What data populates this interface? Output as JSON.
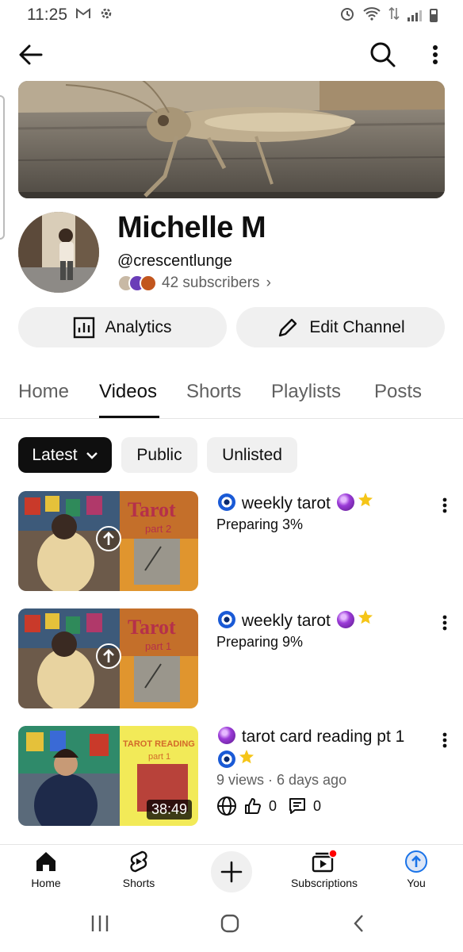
{
  "status_bar": {
    "time": "11:25",
    "left_icons": [
      "gmail-icon",
      "settings-gear-icon"
    ],
    "right_icons": [
      "alarm-icon",
      "wifi-icon",
      "data-arrows-icon",
      "signal-icon",
      "battery-icon"
    ]
  },
  "appbar": {
    "back_icon": "arrow-left-icon",
    "search_icon": "search-icon",
    "more_icon": "more-vert-icon"
  },
  "channel": {
    "name": "Michelle M",
    "handle": "@crescentlunge",
    "subscribers": "42 subscribers",
    "subscribers_chevron": "›"
  },
  "actions": {
    "analytics_label": "Analytics",
    "edit_label": "Edit Channel"
  },
  "tabs": [
    {
      "label": "Home",
      "active": false
    },
    {
      "label": "Videos",
      "active": true
    },
    {
      "label": "Shorts",
      "active": false
    },
    {
      "label": "Playlists",
      "active": false
    },
    {
      "label": "Posts",
      "active": false
    }
  ],
  "chips": {
    "sort_label": "Latest",
    "public_label": "Public",
    "unlisted_label": "Unlisted"
  },
  "videos": [
    {
      "title": "weekly tarot",
      "status": "Preparing 3%",
      "progress": 0.03,
      "thumb_text": "Tarot",
      "thumb_part": "part 2"
    },
    {
      "title": "weekly tarot",
      "status": "Preparing 9%",
      "progress": 0.09,
      "thumb_text": "Tarot",
      "thumb_part": "part 1"
    },
    {
      "title": "tarot card reading pt 1",
      "meta": "9 views · 6 days ago",
      "duration": "38:49",
      "likes": "0",
      "comments": "0",
      "thumb_text": "TAROT READING",
      "thumb_part": "part 1"
    }
  ],
  "bottom_nav": {
    "home": "Home",
    "shorts": "Shorts",
    "subscriptions": "Subscriptions",
    "you": "You"
  },
  "colors": {
    "text_primary": "#0f0f0f",
    "text_secondary": "#606060",
    "chip_bg": "#f0f0f0",
    "accent_blue": "#1a73e8",
    "notification_red": "#ff0000"
  }
}
